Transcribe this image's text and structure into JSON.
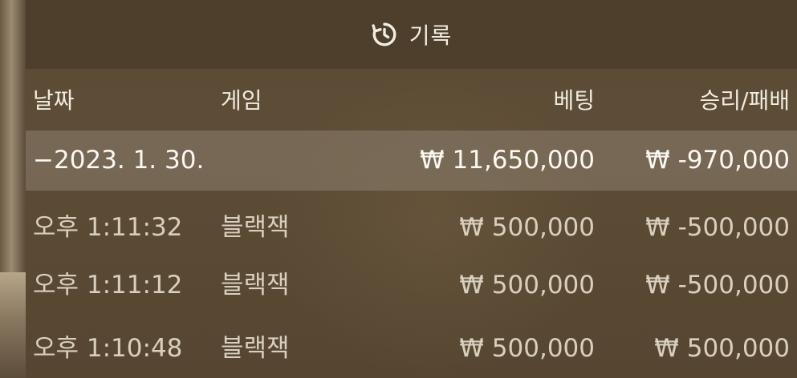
{
  "header": {
    "icon": "history-icon",
    "title": "기록"
  },
  "columns": {
    "date": "날짜",
    "game": "게임",
    "bet": "베팅",
    "result": "승리/패배"
  },
  "group": {
    "date": "−2023. 1. 30.",
    "bet": "₩ 11,650,000",
    "result": "₩ -970,000"
  },
  "rows": [
    {
      "time": "오후 1:11:32",
      "game": "블랙잭",
      "bet": "₩ 500,000",
      "result": "₩ -500,000"
    },
    {
      "time": "오후 1:11:12",
      "game": "블랙잭",
      "bet": "₩ 500,000",
      "result": "₩ -500,000"
    },
    {
      "time": "오후 1:10:48",
      "game": "블랙잭",
      "bet": "₩ 500,000",
      "result": "₩ 500,000"
    }
  ],
  "colors": {
    "header_bg": "#4d3f2b",
    "panel_bg": "#5a4a33",
    "group_bg": "#8c8070",
    "text": "#efe8dc"
  }
}
